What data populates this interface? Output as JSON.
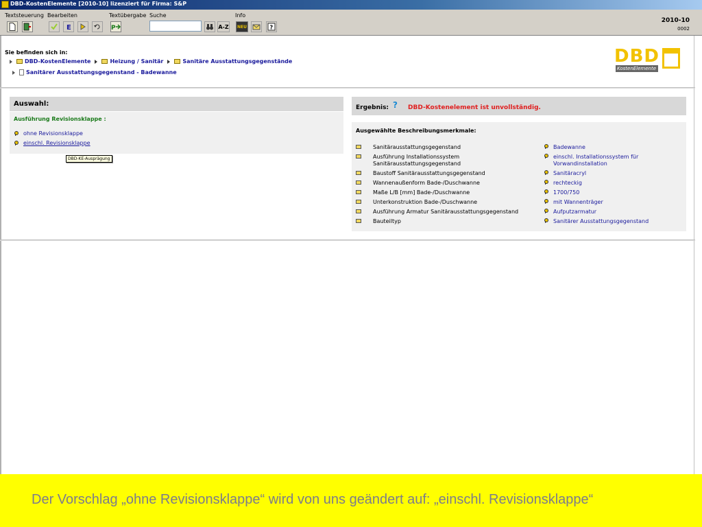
{
  "window": {
    "title": "DBD-KostenElemente [2010-10] lizenziert für Firma: S&P"
  },
  "toolbar": {
    "groups": [
      "Textsteuerung",
      "Bearbeiten",
      "Textübergabe",
      "Suche",
      "Info"
    ],
    "search_value": "",
    "az_label": "A-Z",
    "neu_label": "NEU",
    "version": "2010-10",
    "version_sub": "0002"
  },
  "breadcrumb": {
    "title": "Sie befinden sich in:",
    "items": [
      "DBD-KostenElemente",
      "Heizung / Sanitär",
      "Sanitäre Ausstattungsgegenstände"
    ],
    "current": "Sanitärer Ausstattungsgegenstand - Badewanne"
  },
  "logo": {
    "text": "DBD",
    "sub": "KostenElemente"
  },
  "auswahl": {
    "header": "Auswahl:",
    "heading": "Ausführung Revisionsklappe :",
    "options": [
      "ohne Revisionsklappe",
      "einschl. Revisionsklappe"
    ],
    "tooltip": "DBD-KE-Ausprägung"
  },
  "ergebnis": {
    "label": "Ergebnis:",
    "help": "?",
    "status": "DBD-Kostenelement ist unvollständig.",
    "status_color": "#e02020"
  },
  "merkmale": {
    "heading": "Ausgewählte Beschreibungsmerkmale:",
    "rows": [
      {
        "label": "Sanitärausstattungsgegenstand",
        "value": "Badewanne"
      },
      {
        "label": "Ausführung Installationssystem",
        "label2": "Sanitärausstattungsgegenstand",
        "value": "einschl. Installationssystem für",
        "value2": "Vorwandinstallation"
      },
      {
        "label": "Baustoff Sanitärausstattungsgegenstand",
        "value": "Sanitäracryl"
      },
      {
        "label": "Wannenaußenform Bade-/Duschwanne",
        "value": "rechteckig"
      },
      {
        "label": "Maße L/B [mm] Bade-/Duschwanne",
        "value": "1700/750"
      },
      {
        "label": "Unterkonstruktion Bade-/Duschwanne",
        "value": "mit Wannenträger"
      },
      {
        "label": "Ausführung Armatur Sanitärausstattungsgegenstand",
        "value": "Aufputzarmatur"
      },
      {
        "label": "Bauteiltyp",
        "value": "Sanitärer Ausstattungsgegenstand"
      }
    ]
  },
  "caption": {
    "text": "Der Vorschlag „ohne Revisionsklappe“ wird von uns geändert auf: „einschl. Revisionsklappe“",
    "background": "#ffff00"
  }
}
